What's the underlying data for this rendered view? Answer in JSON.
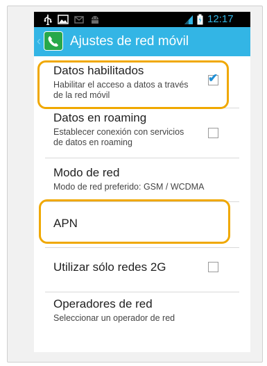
{
  "status_bar": {
    "time": "12:17",
    "left_icons": [
      "usb-icon",
      "image-icon",
      "message-icon",
      "android-icon"
    ],
    "right_icons": [
      "signal-icon",
      "battery-icon"
    ]
  },
  "action_bar": {
    "title": "Ajustes de red móvil",
    "app_icon": "phone-settings-icon"
  },
  "settings": [
    {
      "title": "Datos habilitados",
      "summary": "Habilitar el acceso a datos a través de la red móvil",
      "checkbox": true,
      "checked": true,
      "highlighted": true
    },
    {
      "title": "Datos en roaming",
      "summary": "Establecer conexión con servicios de datos en roaming",
      "checkbox": true,
      "checked": false,
      "highlighted": false
    },
    {
      "title": "Modo de red",
      "summary": "Modo de red preferido: GSM / WCDMA",
      "checkbox": false,
      "highlighted": false
    },
    {
      "title": "APN",
      "summary": "",
      "checkbox": false,
      "highlighted": true
    },
    {
      "title": "Utilizar sólo redes 2G",
      "summary": "",
      "checkbox": true,
      "checked": false,
      "highlighted": false
    },
    {
      "title": "Operadores de red",
      "summary": "Seleccionar un operador de red",
      "checkbox": false,
      "highlighted": false
    }
  ],
  "colors": {
    "accent": "#33b5e5",
    "highlight": "#f0a800",
    "check": "#1e8fd6"
  }
}
